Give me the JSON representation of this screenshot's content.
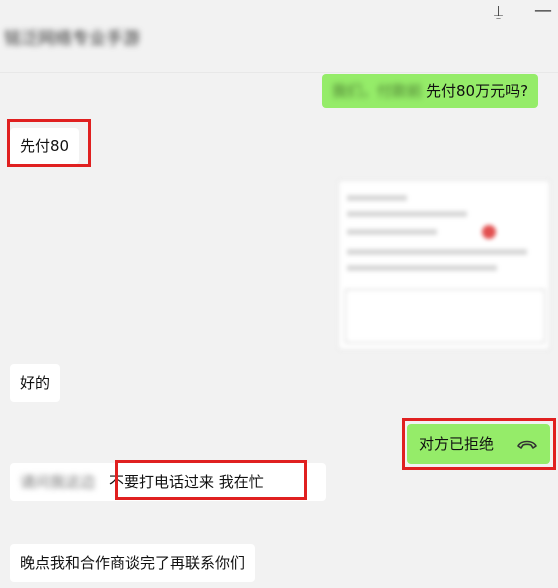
{
  "window": {
    "title": "铭泛网络专业手游",
    "pin_icon": "pin-icon",
    "minimize_icon": "minimize-icon"
  },
  "messages": [
    {
      "side": "out",
      "blurred_prefix": "我们，付款前",
      "text": "先付80万元吗?"
    },
    {
      "side": "in",
      "text": "先付80",
      "highlighted": true
    },
    {
      "side": "out",
      "type": "image"
    },
    {
      "side": "in",
      "text": "好的"
    },
    {
      "side": "out",
      "type": "call",
      "text": "对方已拒绝",
      "icon": "phone-hangup-icon",
      "highlighted": true
    },
    {
      "side": "in",
      "blurred_prefix": "请问我这边",
      "text": "不要打电话过来  我在忙",
      "highlighted": true
    },
    {
      "side": "in",
      "text": "晚点我和合作商谈完了再联系你们"
    }
  ],
  "colors": {
    "outgoing_bubble": "#95ec69",
    "incoming_bubble": "#ffffff",
    "highlight_box": "#e02020",
    "background": "#f2f2f2"
  }
}
